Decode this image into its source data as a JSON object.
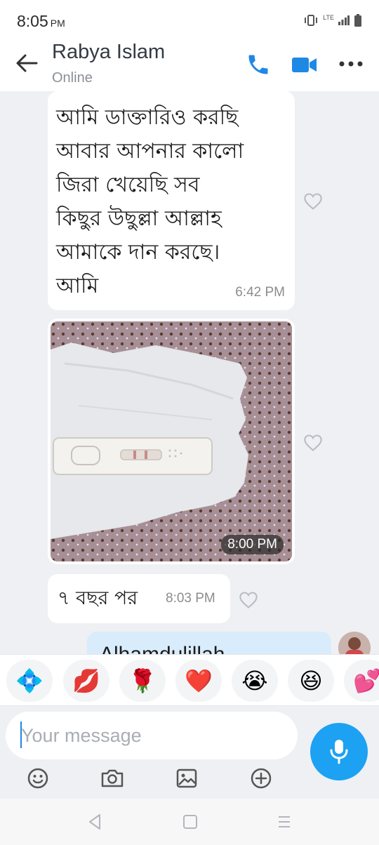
{
  "status_bar": {
    "time": "8:05",
    "ampm": "PM",
    "network": "LTE"
  },
  "header": {
    "contact_name": "Rabya Islam",
    "presence": "Online",
    "icons": [
      "back-arrow-icon",
      "phone-icon",
      "video-camera-icon",
      "more-dots-icon"
    ]
  },
  "messages": [
    {
      "type": "text",
      "direction": "received",
      "lines": [
        "আমি ডাক্তারিও করছি",
        "আবার আপনার কালো",
        "জিরা খেয়েছি সব",
        "কিছুর উছুল্লা আল্লাহ",
        "আমাকে দান করছে।",
        "আমি"
      ],
      "time": "6:42 PM"
    },
    {
      "type": "photo",
      "direction": "received",
      "time": "8:00 PM"
    },
    {
      "type": "text",
      "direction": "received",
      "text": "৭ বছর পর",
      "time": "8:03 PM"
    },
    {
      "type": "text",
      "direction": "sent",
      "text": "Alhamdulillah"
    }
  ],
  "emoji_bar": [
    "💠",
    "💋",
    "🌹",
    "❤️",
    "😭",
    "😆",
    "💕"
  ],
  "composer": {
    "placeholder": "Your message",
    "tools": [
      "emoji-icon",
      "camera-icon",
      "gallery-icon",
      "plus-icon"
    ]
  },
  "colors": {
    "accent": "#1da1f2",
    "header_icon": "#1e88e5",
    "background": "#eef0f3",
    "sent_bubble": "#d9ecfb"
  }
}
